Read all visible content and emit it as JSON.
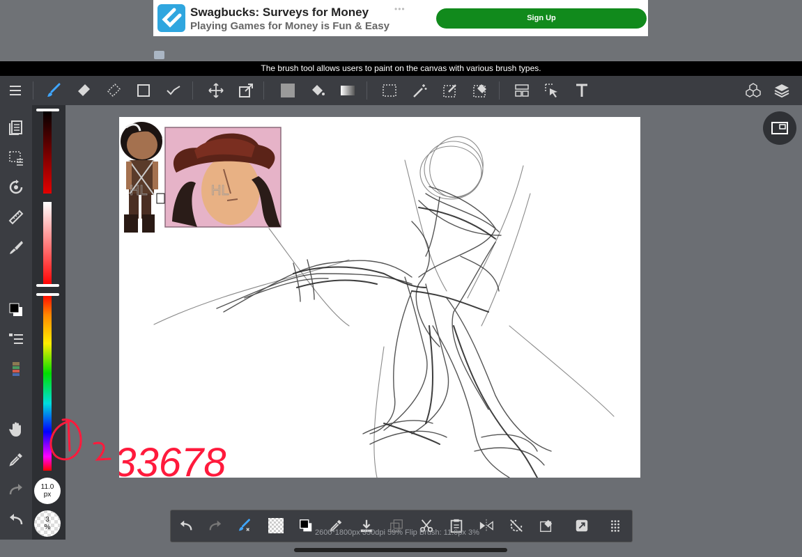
{
  "ad": {
    "title": "Swagbucks: Surveys for Money",
    "subtitle": "Playing Games for Money is Fun & Easy",
    "cta": "Sign Up",
    "brand_color": "#118a1c",
    "logo_color": "#2fa6df"
  },
  "tooltip": "The brush tool allows users to paint on the canvas with various brush types.",
  "toolbar": {
    "icons": [
      "menu-icon",
      "brush-icon",
      "eraser-icon",
      "blur-eraser-icon",
      "rectangle-icon",
      "line-icon",
      "move-icon",
      "transform-icon",
      "fill-color-icon",
      "bucket-icon",
      "gradient-icon",
      "select-rect-icon",
      "magic-wand-icon",
      "select-pen-icon",
      "select-eraser-icon",
      "layout-icon",
      "select-layer-icon",
      "text-icon",
      "3d-material-icon",
      "layers-icon"
    ]
  },
  "leftbar": {
    "icons": [
      "pages-icon",
      "selection-icon",
      "rotate-icon",
      "ruler-icon",
      "paint-icon",
      "color-swap-icon",
      "brush-list-icon",
      "palette-icon",
      "hand-icon",
      "eyedropper-icon",
      "redo-icon",
      "undo-icon"
    ]
  },
  "brush_size": {
    "value": "11.0",
    "unit": "px"
  },
  "opacity": {
    "value": "3",
    "unit": "%"
  },
  "canvas_annotation": "233678",
  "status": "2600*1800px 350dpi 59% Flip Brush: 11.0px 3%",
  "colors": {
    "active_red": "#e30000",
    "annotation": "#ff1a3c"
  }
}
